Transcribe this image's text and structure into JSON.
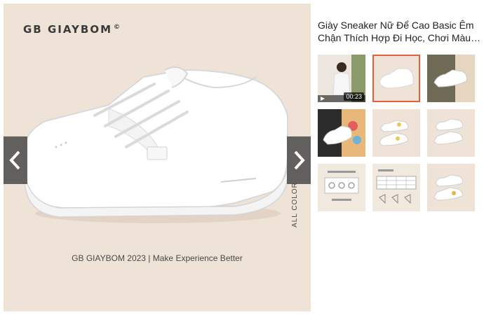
{
  "gallery": {
    "brand": "GB GIAYBOM",
    "brand_mark": "©",
    "tagline": "GB GIAYBOM 2023 | Make Experience Better",
    "side_label": "ALL COLOR",
    "prev_icon": "chevron-left-icon",
    "next_icon": "chevron-right-icon"
  },
  "product": {
    "title": "Giày Sneaker Nữ Để Cao Basic Êm Chận Thích Hợp Đi Học, Chơi Màu…"
  },
  "thumbnails": [
    {
      "type": "video",
      "duration": "00:23"
    },
    {
      "type": "image",
      "selected": true
    },
    {
      "type": "image"
    },
    {
      "type": "image"
    },
    {
      "type": "image"
    },
    {
      "type": "image"
    },
    {
      "type": "image"
    },
    {
      "type": "image"
    },
    {
      "type": "image"
    }
  ],
  "colors": {
    "background": "#efe3d8",
    "nav_button": "#555555",
    "selected_border": "#e0603a"
  }
}
